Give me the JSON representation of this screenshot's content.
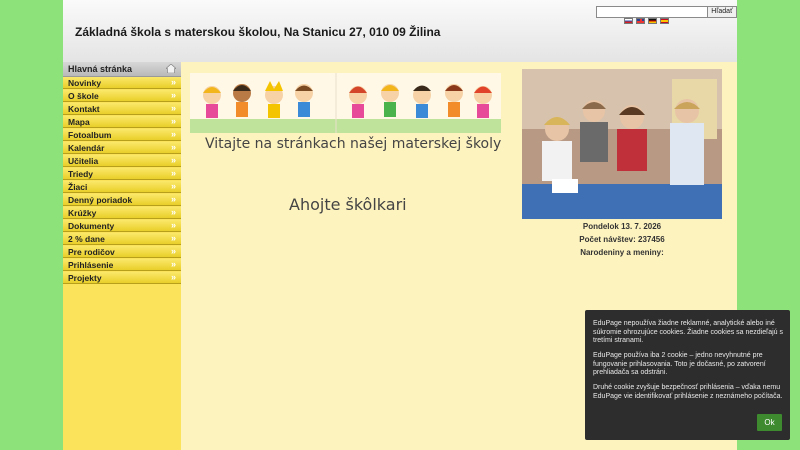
{
  "header": {
    "title": "Základná škola s materskou školou, Na Stanicu 27, 010 09 Žilina",
    "search_placeholder": "",
    "search_button": "Hľadať"
  },
  "sidebar": {
    "home": "Hlavná stránka",
    "items": [
      {
        "label": "Novinky"
      },
      {
        "label": "O škole"
      },
      {
        "label": "Kontakt"
      },
      {
        "label": "Mapa"
      },
      {
        "label": "Fotoalbum"
      },
      {
        "label": "Kalendár"
      },
      {
        "label": "Učitelia"
      },
      {
        "label": "Triedy"
      },
      {
        "label": "Žiaci"
      },
      {
        "label": "Denný poriadok"
      },
      {
        "label": "Krúžky"
      },
      {
        "label": "Dokumenty"
      },
      {
        "label": "2 % dane"
      },
      {
        "label": "Pre rodičov"
      },
      {
        "label": "Prihlásenie"
      },
      {
        "label": "Projekty"
      }
    ],
    "chevron": "»"
  },
  "main": {
    "welcome": "Vitajte na stránkach našej materskej školy",
    "greeting": "Ahojte škôlkari"
  },
  "info": {
    "date": "Pondelok 13. 7. 2026",
    "visits": "Počet návštev: 237456",
    "namedays": "Narodeniny a meniny:"
  },
  "cookie": {
    "p1": "EduPage nepoužíva žiadne reklamné, analytické alebo iné súkromie ohrozujúce cookies. Žiadne cookies sa nezdieľajú s tretími stranami.",
    "p2": "EduPage používa iba 2 cookie – jedno nevyhnutné pre fungovanie prihlasovania. Toto je dočasné, po zatvorení prehliadača sa odstráni.",
    "p3": "Druhé cookie zvyšuje bezpečnosť prihlásenia – vďaka nemu EduPage vie identifikovať prihlásenie z neznámeho počítača.",
    "ok": "Ok"
  },
  "colors": {
    "outer": "#8de37a",
    "page": "#fdf3bf",
    "menu": "#fbe45c",
    "cookie_bg": "#2d2d2d",
    "ok_button": "#3d8a2f"
  }
}
